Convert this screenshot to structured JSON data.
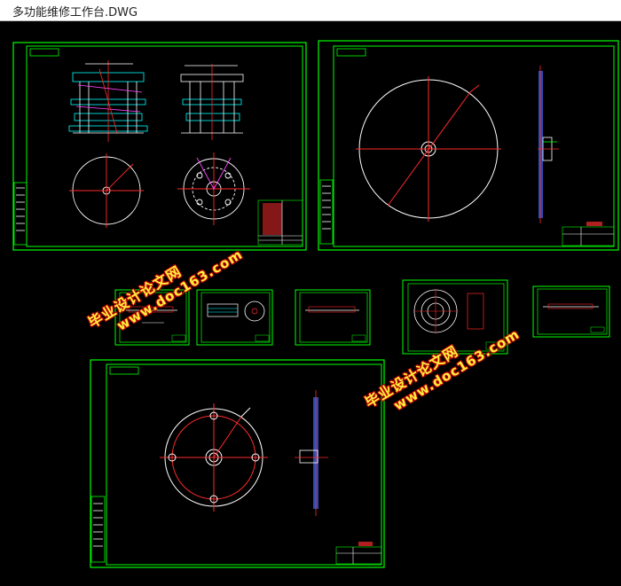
{
  "window": {
    "title": "多功能维修工作台.DWG"
  },
  "watermark": {
    "line1": "毕业设计论文网",
    "line2": "www.doc163.com"
  },
  "colors": {
    "frame": "#00ff00",
    "line_white": "#ffffff",
    "line_red": "#ff2a2a",
    "line_cyan": "#00ffff",
    "line_magenta": "#ff44ff",
    "watermark_text": "#ffef3f",
    "watermark_outline": "#c00000"
  }
}
